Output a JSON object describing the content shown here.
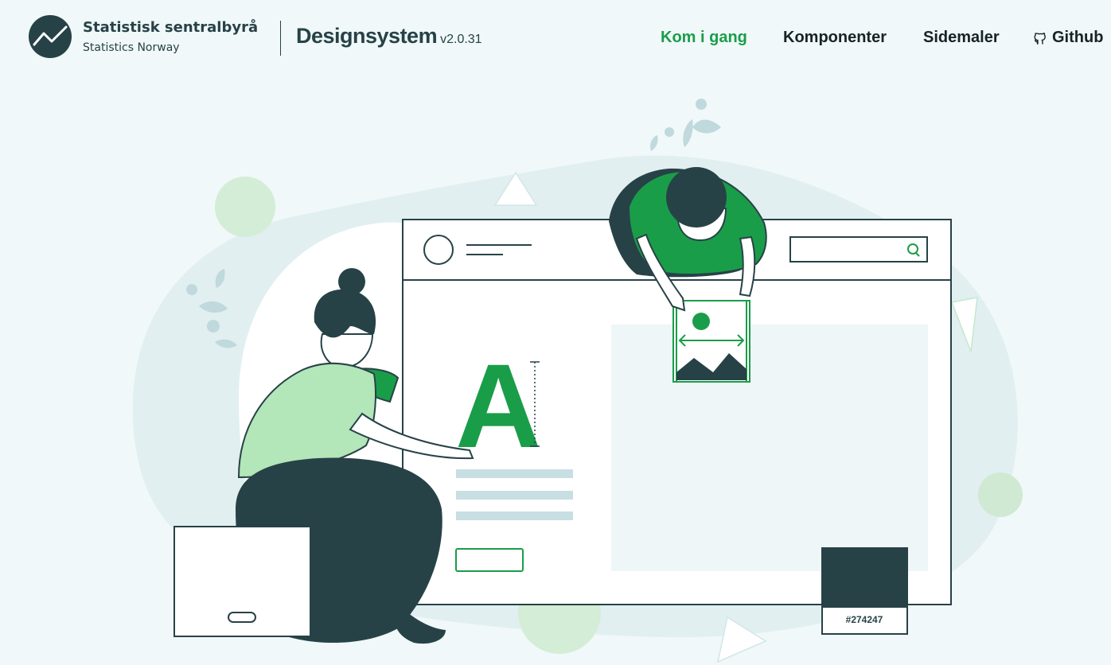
{
  "header": {
    "org_name": "Statistisk sentralbyrå",
    "org_sub": "Statistics Norway",
    "brand_title": "Designsystem",
    "brand_version": "v2.0.31"
  },
  "nav": {
    "items": [
      {
        "label": "Kom i gang",
        "active": true
      },
      {
        "label": "Komponenter",
        "active": false
      },
      {
        "label": "Sidemaler",
        "active": false
      },
      {
        "label": "Github",
        "active": false,
        "icon": "github-icon"
      }
    ]
  },
  "hero": {
    "typography_letter": "A",
    "swatch_label": "#274247"
  },
  "colors": {
    "primary_dark": "#274247",
    "accent_green": "#1a9d49",
    "light_green": "#b3e6b8",
    "background": "#f0f8f9"
  }
}
